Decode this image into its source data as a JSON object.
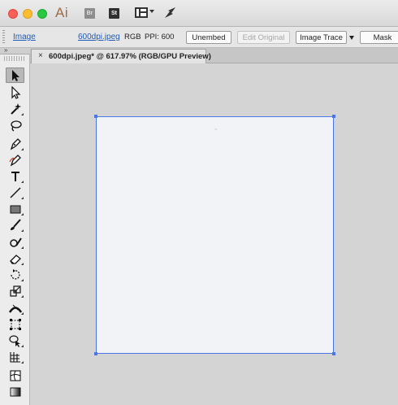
{
  "titlebar": {
    "app_logo": "Ai",
    "bridge_badge": "Br",
    "stock_badge": "St",
    "icons": [
      "arrange-documents-icon",
      "gpu-performance-icon"
    ]
  },
  "control_bar": {
    "object_type": "Image",
    "file_link": "600dpi.jpeg",
    "color_mode": "RGB",
    "ppi": "PPI: 600",
    "unembed": "Unembed",
    "edit_original": "Edit Original",
    "image_trace": "Image Trace",
    "mask": "Mask"
  },
  "document": {
    "tab_close": "×",
    "tab_title": "600dpi.jpeg* @ 617.97% (RGB/GPU Preview)"
  },
  "tools_panel": {
    "collapse_label": "»",
    "tools": [
      "selection-tool",
      "direct-selection-tool",
      "magic-wand-tool",
      "lasso-tool",
      "pen-tool",
      "curvature-tool",
      "type-tool",
      "line-segment-tool",
      "rectangle-tool",
      "paintbrush-tool",
      "shaper-tool",
      "eraser-tool",
      "rotate-tool",
      "scale-tool",
      "width-tool",
      "free-transform-tool",
      "shape-builder-tool",
      "perspective-grid-tool",
      "mesh-tool",
      "gradient-tool"
    ]
  },
  "colors": {
    "selection_bounds": "#4a76e8",
    "link": "#1e5bb8",
    "ai_logo": "#9e6b45"
  }
}
